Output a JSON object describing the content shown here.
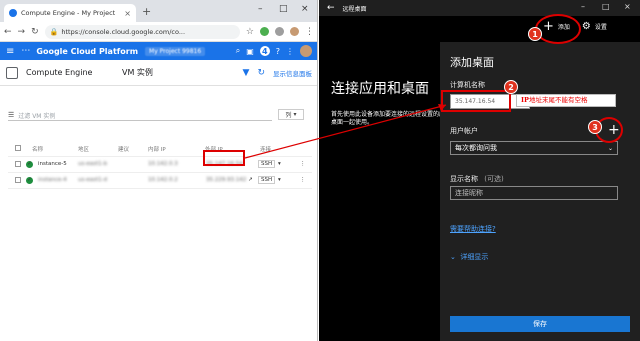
{
  "browser": {
    "tab_title": "Compute Engine - My Project",
    "url": "https://console.cloud.google.com/co...",
    "extension_badge": "4"
  },
  "gcp": {
    "brand": "Google Cloud Platform",
    "project": "My Project 99816",
    "product": "Compute Engine",
    "page": "VM 实例",
    "info_link": "显示信息面板",
    "filter_placeholder": "过滤 VM 实例",
    "columns_button": "列",
    "table": {
      "headers": [
        "名称",
        "地区",
        "建议",
        "内部 IP",
        "外部 IP",
        "连接"
      ],
      "rows": [
        {
          "name": "instance-5",
          "zone": "us-east1-b",
          "internal_ip": "10.142.0.3",
          "external_ip": "35.147.16.54",
          "connect": "SSH"
        },
        {
          "name": "instance-4",
          "zone": "us-east1-d",
          "internal_ip": "10.142.0.2",
          "external_ip": "35.229.93.142",
          "connect": "SSH"
        }
      ]
    }
  },
  "remote_desktop": {
    "window_title": "远程桌面",
    "add_label": "添加",
    "settings_label": "设置",
    "hero_title": "连接应用和桌面",
    "hero_subtitle": "首先使用此设备添加要连接的远程设置的应用和桌面一起使用。",
    "panel_title": "添加桌面",
    "computer_name_label": "计算机名称",
    "computer_name_value": "35.147.16.54",
    "user_account_label": "用户帐户",
    "user_account_value": "每次都询问我",
    "display_name_label": "显示名称",
    "display_name_optional": "(可选)",
    "display_name_placeholder": "连接昵称",
    "help_link": "需要帮助连接?",
    "more_label": "详细显示",
    "save_label": "保存"
  },
  "annotations": {
    "step1": "1",
    "step2": "2",
    "step3": "3",
    "note_prefix": "IP",
    "note_text": "地址末尾不能有空格"
  },
  "colors": {
    "gcp_blue": "#1a73e8",
    "annotation_red": "#dd0000",
    "rd_panel": "#202020",
    "rd_accent": "#1976d2"
  }
}
